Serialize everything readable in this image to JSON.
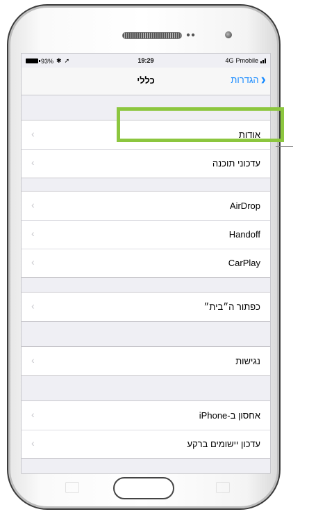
{
  "status_bar": {
    "battery": "93%",
    "time": "19:29",
    "network": "4G",
    "carrier": "Pmobile"
  },
  "nav": {
    "title": "כללי",
    "back_label": "הגדרות"
  },
  "groups": [
    {
      "rows": [
        {
          "label": "אודות"
        },
        {
          "label": "עדכוני תוכנה"
        }
      ]
    },
    {
      "rows": [
        {
          "label": "AirDrop"
        },
        {
          "label": "Handoff"
        },
        {
          "label": "CarPlay"
        }
      ]
    },
    {
      "rows": [
        {
          "label": "כפתור ה״בית״"
        }
      ]
    },
    {
      "rows": [
        {
          "label": "נגישות"
        }
      ]
    },
    {
      "rows": [
        {
          "label": "אחסון ב-iPhone"
        },
        {
          "label": "עדכון יישומים ברקע"
        }
      ]
    }
  ],
  "colors": {
    "accent": "#1a8cff",
    "highlight": "#8cc63f",
    "background": "#efeff4"
  },
  "icons": {
    "chevron": "chevron-left-icon",
    "back": "chevron-right-icon"
  }
}
